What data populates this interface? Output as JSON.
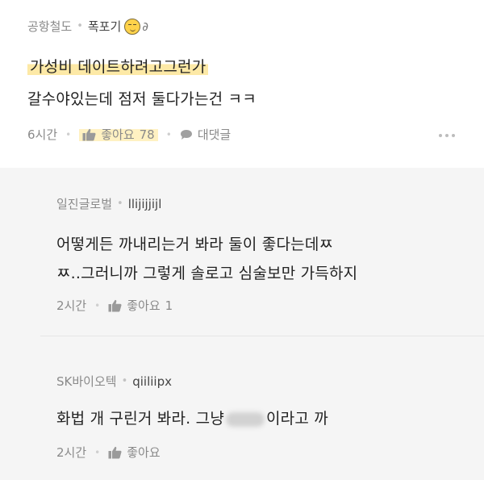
{
  "main_comment": {
    "author": "공항철도",
    "handle": "폭포기",
    "line1": "가성비 데이트하려고그런가",
    "line2": "갈수야있는데 점저 둘다가는건 ㅋㅋ",
    "time": "6시간",
    "like_label": "좋아요",
    "like_count": "78",
    "reply_label": "대댓글"
  },
  "replies": [
    {
      "author": "일진글로벌",
      "handle": "llijijjijl",
      "line1": "어떻게든 까내리는거 봐라 둘이 좋다는데ㅉ",
      "line2": "ㅉ..그러니까 그렇게 솔로고 심술보만 가득하지",
      "time": "2시간",
      "like_label": "좋아요",
      "like_count": "1"
    },
    {
      "author": "SK바이오텍",
      "handle": "qiiliipx",
      "text_before": "화법 개 구린거 봐라. 그냥",
      "text_after": "이라고 까",
      "time": "2시간",
      "like_label": "좋아요"
    }
  ],
  "colors": {
    "highlight": "#fde9a6",
    "reply_background": "#f5f5f5",
    "meta_gray": "#8a8a8a"
  }
}
